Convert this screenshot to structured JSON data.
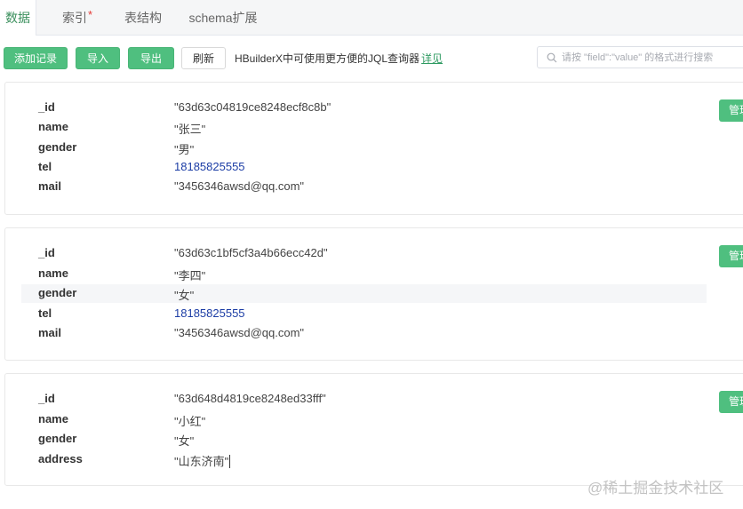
{
  "tabs": [
    {
      "label": "数据",
      "active": true
    },
    {
      "label": "索引",
      "marker": "*"
    },
    {
      "label": "表结构"
    },
    {
      "label": "schema扩展"
    }
  ],
  "toolbar": {
    "add_label": "添加记录",
    "import_label": "导入",
    "export_label": "导出",
    "refresh_label": "刷新",
    "tip_text": "HBuilderX中可使用更方便的JQL查询器",
    "tip_link": "详见",
    "search_placeholder": "请按 \"field\":\"value\" 的格式进行搜索"
  },
  "records": [
    {
      "manage_label": "管理",
      "fields": [
        {
          "key": "_id",
          "value": "\"63d63c04819ce8248ecf8c8b\""
        },
        {
          "key": "name",
          "value": "\"张三\""
        },
        {
          "key": "gender",
          "value": "\"男\""
        },
        {
          "key": "tel",
          "value": "18185825555"
        },
        {
          "key": "mail",
          "value": "\"3456346awsd@qq.com\""
        }
      ]
    },
    {
      "manage_label": "管理",
      "fields": [
        {
          "key": "_id",
          "value": "\"63d63c1bf5cf3a4b66ecc42d\""
        },
        {
          "key": "name",
          "value": "\"李四\""
        },
        {
          "key": "gender",
          "value": "\"女\""
        },
        {
          "key": "tel",
          "value": "18185825555"
        },
        {
          "key": "mail",
          "value": "\"3456346awsd@qq.com\""
        }
      ]
    },
    {
      "manage_label": "管理",
      "fields": [
        {
          "key": "_id",
          "value": "\"63d648d4819ce8248ed33fff\""
        },
        {
          "key": "name",
          "value": "\"小红\""
        },
        {
          "key": "gender",
          "value": "\"女\""
        },
        {
          "key": "address",
          "value": "\"山东济南\""
        }
      ]
    }
  ],
  "watermark": "@稀土掘金技术社区",
  "colors": {
    "accent": "#4fbf7f",
    "link": "#2f9b62",
    "number": "#1c3da5",
    "required_marker": "#e53935"
  }
}
